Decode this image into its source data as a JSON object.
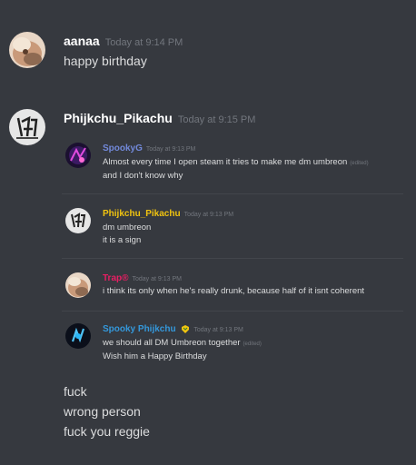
{
  "messages": [
    {
      "author": "aanaa",
      "timestamp": "Today at 9:14 PM",
      "lines": [
        "happy birthday"
      ]
    },
    {
      "author": "Phijkchu_Pikachu",
      "timestamp": "Today at 9:15 PM",
      "quoted": [
        {
          "author": "SpookyG",
          "author_color": "#7289da",
          "timestamp": "Today at 9:13 PM",
          "lines": [
            "Almost every time I open steam it tries to make me dm umbreon",
            "and I don't know why"
          ],
          "edited": "(edited)"
        },
        {
          "author": "Phijkchu_Pikachu",
          "author_color": "#f1c40f",
          "timestamp": "Today at 9:13 PM",
          "lines": [
            "dm umbreon",
            "it is a sign"
          ]
        },
        {
          "author": "Trap®",
          "author_color": "#e91e63",
          "timestamp": "Today at 9:13 PM",
          "lines": [
            "i think its only when he's really drunk, because half of it isnt coherent"
          ]
        },
        {
          "author": "Spooky Phijkchu",
          "author_color": "#3498db",
          "timestamp": "Today at 9:13 PM",
          "lines": [
            "we should all DM Umbreon together",
            "Wish him a Happy Birthday"
          ],
          "edited": "(edited)"
        }
      ],
      "lines": [
        "fuck",
        "wrong person",
        "fuck you reggie"
      ]
    }
  ],
  "colors": {
    "background": "#36393f",
    "timestamp": "#72767d",
    "text": "#dcddde"
  }
}
